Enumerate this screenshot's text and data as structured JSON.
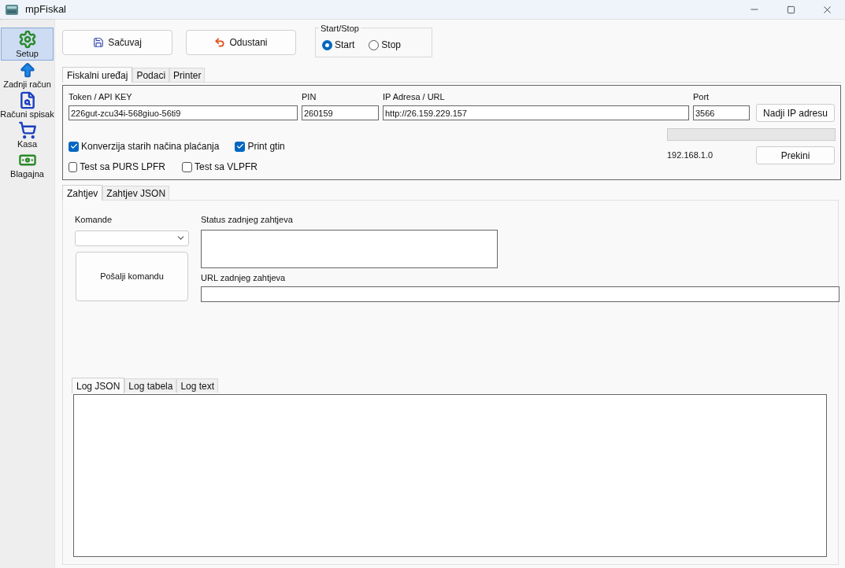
{
  "window": {
    "title": "mpFiskal"
  },
  "sidebar": {
    "items": [
      {
        "label": "Setup",
        "selected": true
      },
      {
        "label": "Zadnji račun",
        "selected": false
      },
      {
        "label": "Računi spisak",
        "selected": false
      },
      {
        "label": "Kasa",
        "selected": false
      },
      {
        "label": "Blagajna",
        "selected": false
      }
    ]
  },
  "toolbar": {
    "buttons": [
      {
        "label": "Sačuvaj"
      },
      {
        "label": "Odustani"
      }
    ],
    "start_stop": {
      "title": "Start/Stop",
      "options": [
        {
          "label": "Start",
          "selected": true
        },
        {
          "label": "Stop",
          "selected": false
        }
      ]
    }
  },
  "settings_tabs": [
    {
      "label": "Fiskalni uređaj",
      "selected": true
    },
    {
      "label": "Podaci",
      "selected": false
    },
    {
      "label": "Printer",
      "selected": false
    }
  ],
  "device": {
    "token": {
      "label": "Token / API KEY",
      "value": "226gut-zcu34i-568giuo-56ti9"
    },
    "pin": {
      "label": "PIN",
      "value": "260159"
    },
    "ip": {
      "label": "IP Adresa / URL",
      "value": "http://26.159.229.157"
    },
    "port": {
      "label": "Port",
      "value": "3566"
    },
    "find_button": "Nadji IP adresu",
    "scan_progress": {
      "level": 0
    },
    "scan_address": "192.168.1.0",
    "stop_button": "Prekini",
    "checkboxes": [
      {
        "label": "Konverzija starih načina plaćanja",
        "checked": true
      },
      {
        "label": "Print gtin",
        "checked": true
      },
      {
        "label": "Test sa PURS LPFR",
        "checked": false
      },
      {
        "label": "Test sa VLPFR",
        "checked": false
      }
    ]
  },
  "request_tabs": [
    {
      "label": "Zahtjev",
      "selected": true
    },
    {
      "label": "Zahtjev JSON",
      "selected": false
    }
  ],
  "request": {
    "commands_label": "Komande",
    "send_button": "Pošalji komandu",
    "status_label": "Status zadnjeg zahtjeva",
    "url_label": "URL zadnjeg zahtjeva"
  },
  "log_tabs": [
    {
      "label": "Log JSON",
      "selected": true
    },
    {
      "label": "Log tabela",
      "selected": false
    },
    {
      "label": "Log text",
      "selected": false
    }
  ]
}
